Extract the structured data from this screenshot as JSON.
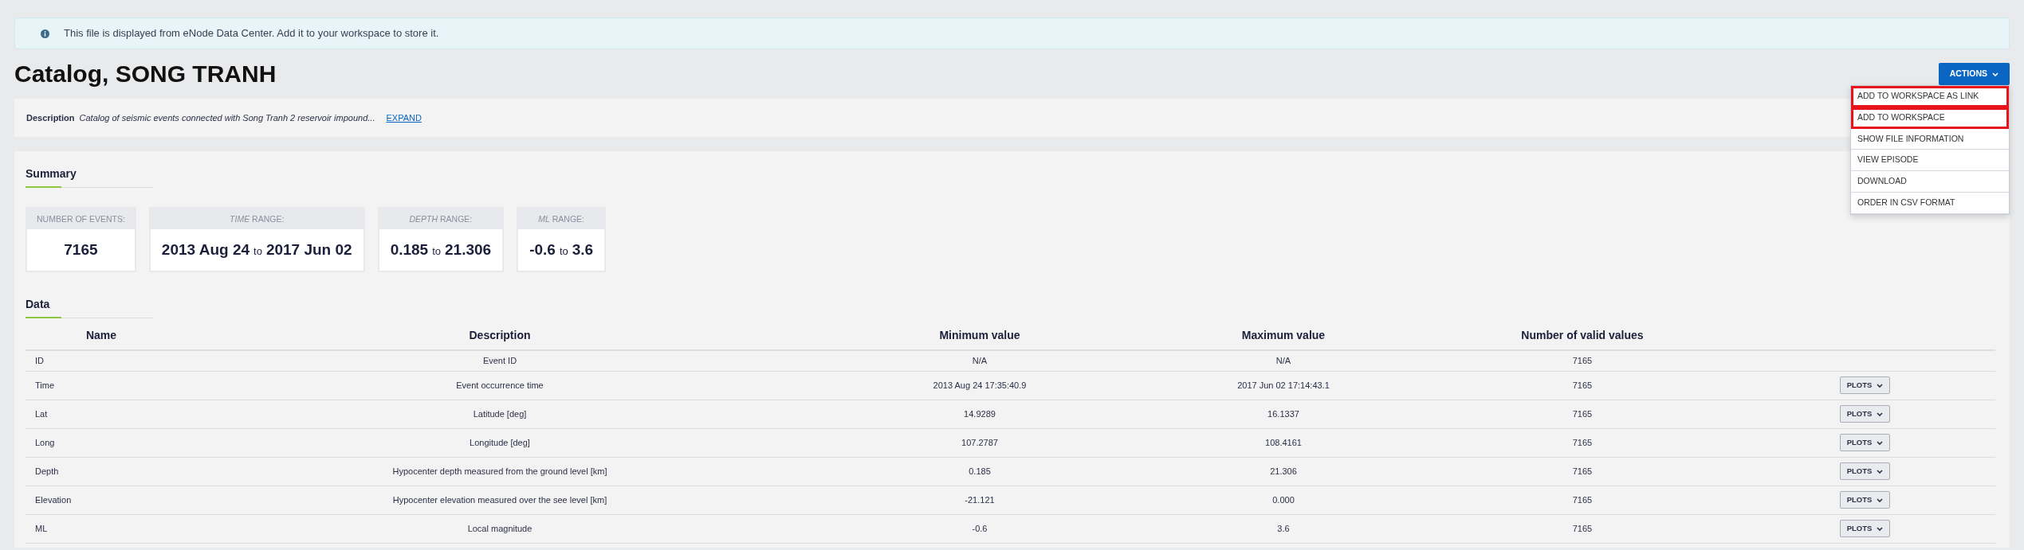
{
  "alert": {
    "text": "This file is displayed from eNode Data Center. Add it to your workspace to store it."
  },
  "title": "Catalog, SONG TRANH",
  "actions": {
    "label": "ACTIONS",
    "expanded": true,
    "items": [
      {
        "label": "ADD TO WORKSPACE AS LINK",
        "highlighted": true
      },
      {
        "label": "ADD TO WORKSPACE",
        "highlighted": true
      },
      {
        "label": "SHOW FILE INFORMATION",
        "highlighted": false
      },
      {
        "label": "VIEW EPISODE",
        "highlighted": false
      },
      {
        "label": "DOWNLOAD",
        "highlighted": false
      },
      {
        "label": "ORDER IN CSV FORMAT",
        "highlighted": false
      }
    ]
  },
  "description": {
    "label": "Description",
    "text": "Catalog of seismic events connected with Song Tranh 2 reservoir impound...",
    "link": "EXPAND"
  },
  "summary": {
    "heading": "Summary",
    "cards": [
      {
        "kind": "single",
        "label": "NUMBER OF EVENTS:",
        "value": "7165"
      },
      {
        "kind": "range",
        "label": "*TIME* RANGE:",
        "from": "2013 Aug 24",
        "joiner": "to",
        "to": "2017 Jun 02"
      },
      {
        "kind": "range",
        "label": "*DEPTH* RANGE:",
        "from": "0.185",
        "joiner": "to",
        "to": "21.306"
      },
      {
        "kind": "range",
        "label": "*ML* RANGE:",
        "from": "-0.6",
        "joiner": "to",
        "to": "3.6"
      }
    ]
  },
  "data": {
    "heading": "Data",
    "columns": [
      "Name",
      "Description",
      "Minimum value",
      "Maximum value",
      "Number of valid values"
    ],
    "rows": [
      {
        "cells": [
          "ID",
          "Event ID",
          "N/A",
          "N/A",
          "7165"
        ]
      },
      {
        "cells": [
          "Time",
          "Event occurrence time",
          "2013 Aug 24 17:35:40.9",
          "2017 Jun 02 17:14:43.1",
          "7165"
        ],
        "plots": "PLOTS"
      },
      {
        "cells": [
          "Lat",
          "Latitude [deg]",
          "14.9289",
          "16.1337",
          "7165"
        ],
        "plots": "PLOTS"
      },
      {
        "cells": [
          "Long",
          "Longitude [deg]",
          "107.2787",
          "108.4161",
          "7165"
        ],
        "plots": "PLOTS"
      },
      {
        "cells": [
          "Depth",
          "Hypocenter depth measured from the ground level [km]",
          "0.185",
          "21.306",
          "7165"
        ],
        "plots": "PLOTS"
      },
      {
        "cells": [
          "Elevation",
          "Hypocenter elevation measured over the see level [km]",
          "-21.121",
          "0.000",
          "7165"
        ],
        "plots": "PLOTS"
      },
      {
        "cells": [
          "ML",
          "Local magnitude",
          "-0.6",
          "3.6",
          "7165"
        ],
        "plots": "PLOTS"
      }
    ]
  }
}
